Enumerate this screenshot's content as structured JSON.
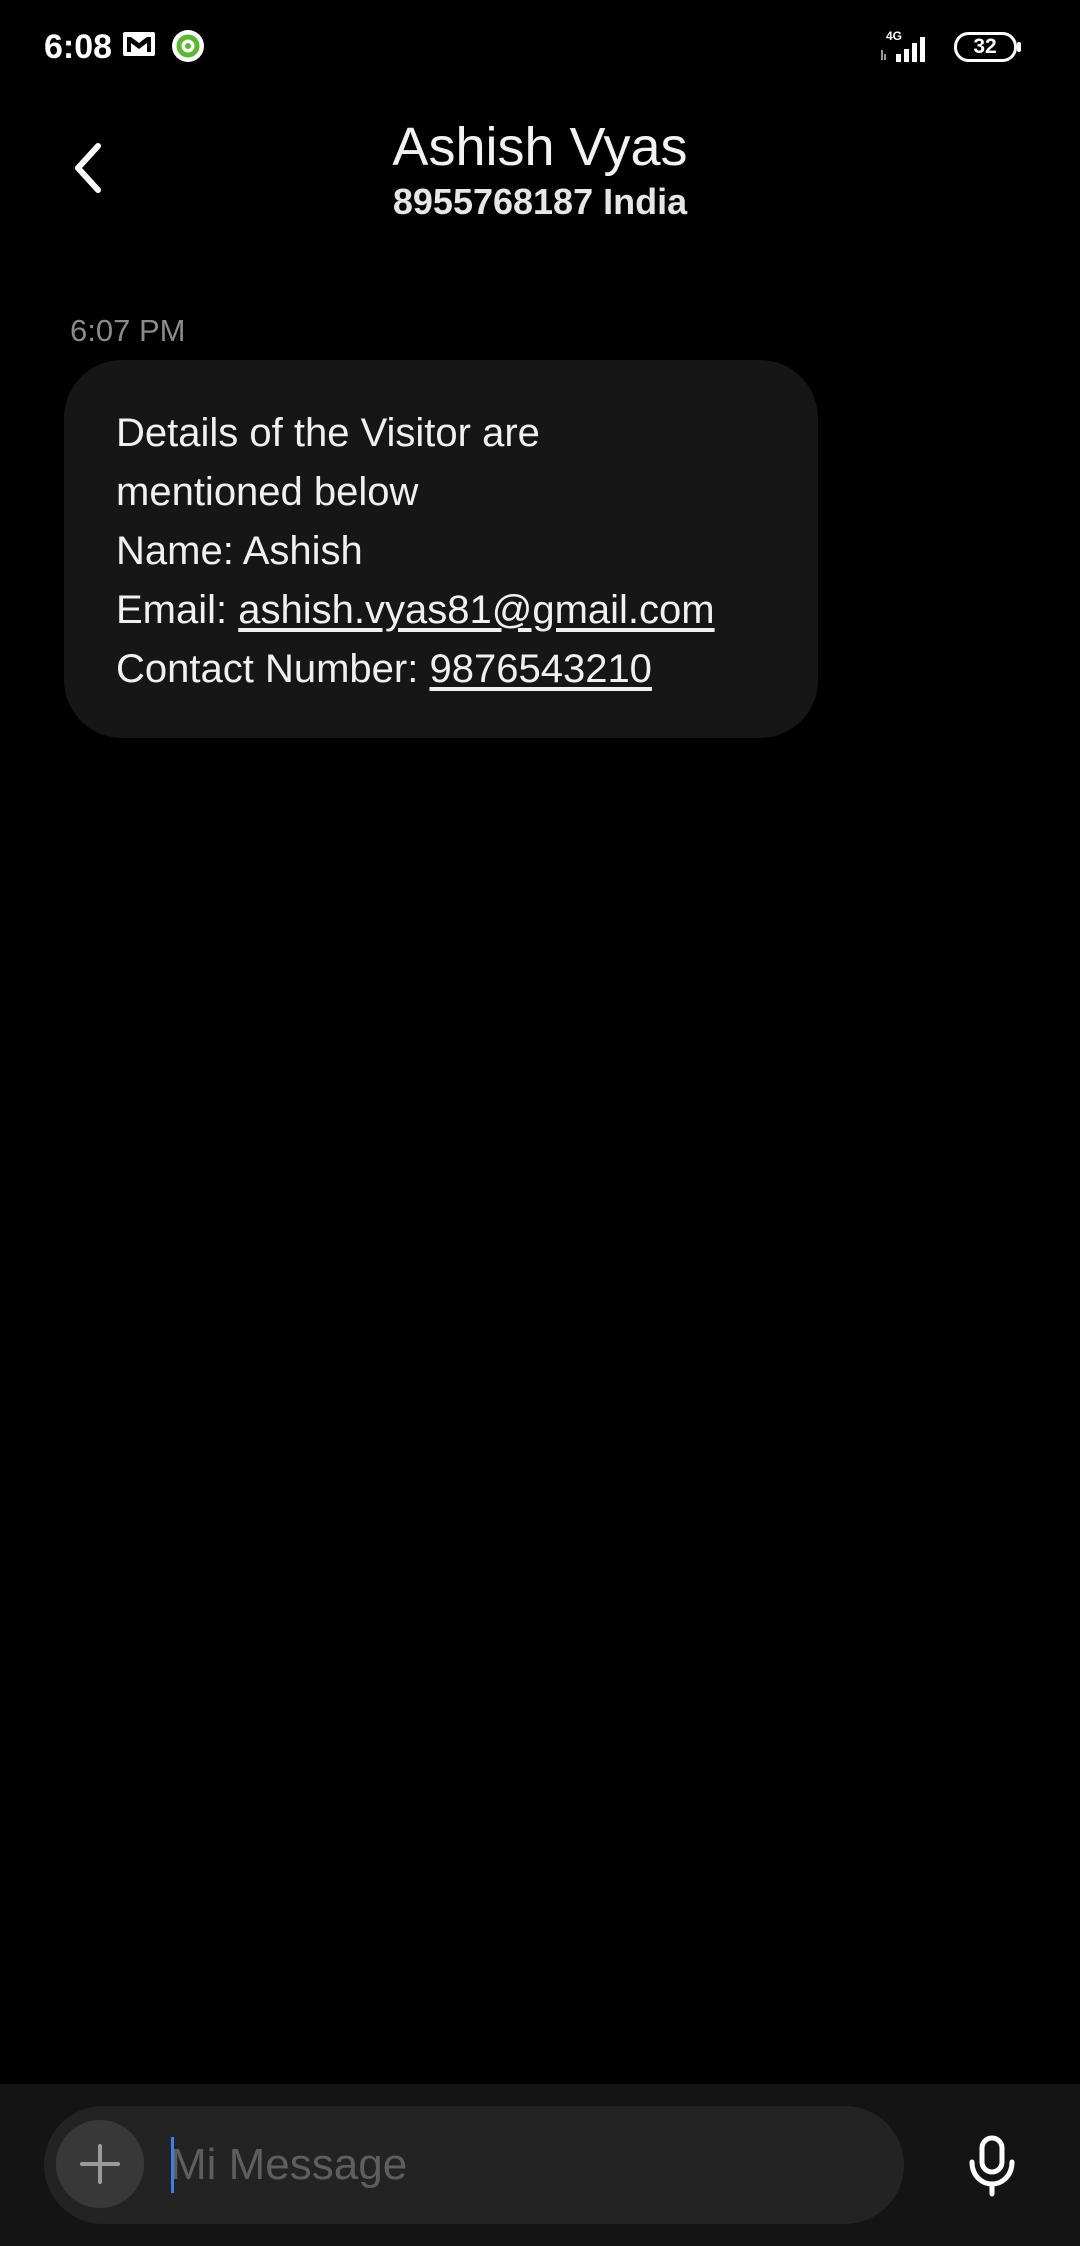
{
  "status_bar": {
    "time": "6:08",
    "mail_icon": "mail-icon",
    "app_icon": "green-ring-app-icon",
    "network_label": "4G",
    "battery_level": "32"
  },
  "header": {
    "back_icon": "chevron-left-icon",
    "contact_name": "Ashish Vyas",
    "contact_subtitle": "8955768187 India"
  },
  "conversation": {
    "timestamp": "6:07 PM",
    "message": {
      "line1": "Details of the Visitor are",
      "line2": "mentioned below",
      "line3": "Name: Ashish",
      "email_label": "Email: ",
      "email_value": "ashish.vyas81@gmail.com",
      "contact_label": "Contact Number: ",
      "contact_value": "9876543210"
    }
  },
  "composer": {
    "attach_icon": "plus-icon",
    "placeholder": "Mi Message",
    "mic_icon": "microphone-icon"
  },
  "colors": {
    "background": "#000000",
    "bubble": "#161616",
    "composer_bar": "#141414",
    "composer_field": "#232323",
    "cursor": "#3d7df2",
    "timestamp": "#8a8a8a"
  }
}
